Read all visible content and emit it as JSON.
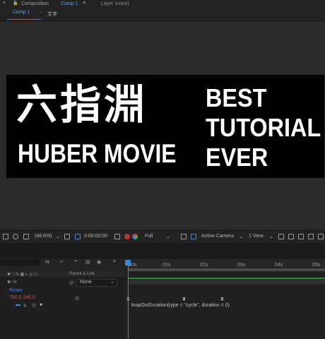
{
  "panel": {
    "close": "×",
    "lock": "🔓",
    "title_prefix": "Composition",
    "comp_name": "Comp 1",
    "menu": "≡",
    "layer_title": "Layer (none)"
  },
  "tabs": {
    "comp": "Comp 1",
    "text": "文字"
  },
  "artboard": {
    "cjk_title": "六指淵",
    "brand": "HUBER MOVIE",
    "line1": "BEST",
    "line2": "TUTORIAL",
    "line3": "EVER"
  },
  "viewer_toolbar": {
    "zoom": "(48.6%)",
    "timecode": "0:00:00:00",
    "resolution": "Full",
    "camera": "Active Camera",
    "views": "1 View"
  },
  "timeline": {
    "parent_link_label": "Parent & Link",
    "parent_value": "None",
    "reset_label": "Reset",
    "position_value": "750.0,240.0",
    "expression": "loopOutDuration(type = \"cycle\", duration = 0)",
    "ruler_ticks": [
      "00s",
      "01s",
      "02s",
      "03s",
      "04s",
      "05s"
    ]
  },
  "colors": {
    "accent": "#3a87e0",
    "value_red": "#e0463a",
    "green_bar": "#1f8a2c"
  }
}
